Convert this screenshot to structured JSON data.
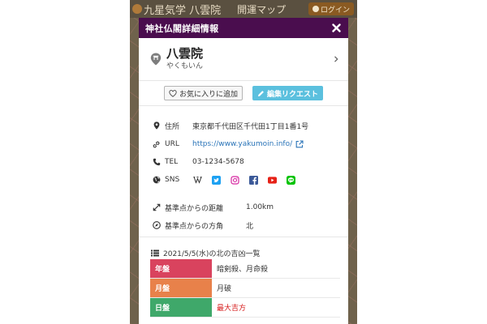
{
  "background": {
    "site_title": "九星気学 八雲院",
    "map_label": "開運マップ",
    "login_label": "ログイン"
  },
  "modal": {
    "title": "神社仏閣詳細情報",
    "shrine": {
      "name": "八雲院",
      "kana": "やくもいん"
    },
    "favorite_button": "お気に入りに追加",
    "edit_button": "編集リクエスト",
    "info": {
      "address_label": "住所",
      "address_value": "東京都千代田区千代田1丁目1番1号",
      "url_label": "URL",
      "url_value": "https://www.yakumoin.info/",
      "tel_label": "TEL",
      "tel_value": "03-1234-5678",
      "sns_label": "SNS",
      "sns_icons": [
        "wikipedia-icon",
        "twitter-icon",
        "instagram-icon",
        "facebook-icon",
        "youtube-icon",
        "line-icon"
      ],
      "distance_label": "基準点からの距離",
      "distance_value": "1.00km",
      "direction_label": "基準点からの方角",
      "direction_value": "北"
    },
    "fortune": {
      "heading": "2021/5/5(水)の北の吉凶一覧",
      "rows": [
        {
          "label": "年盤",
          "value": "暗剣殺、月命殺",
          "label_color": "#d9435e",
          "value_color": "#333333"
        },
        {
          "label": "月盤",
          "value": "月破",
          "label_color": "#e8814a",
          "value_color": "#333333"
        },
        {
          "label": "日盤",
          "value": "最大吉方",
          "label_color": "#3fa86a",
          "value_color": "#d61a1a"
        }
      ]
    }
  },
  "colors": {
    "header_bg": "#4a0d4e",
    "edit_button_bg": "#5bc0de",
    "link": "#2a74b8"
  }
}
